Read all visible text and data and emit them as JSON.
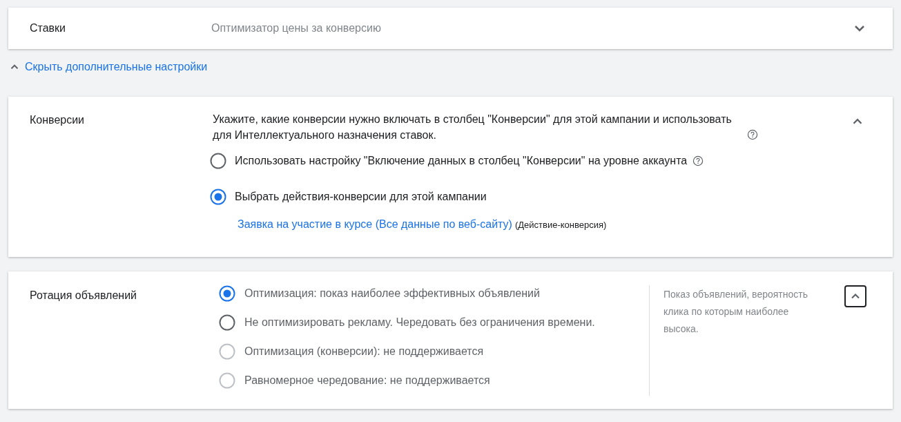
{
  "bids": {
    "label": "Ставки",
    "value": "Оптимизатор цены за конверсию",
    "expanded": false
  },
  "toggle_link": {
    "label": "Скрыть дополнительные настройки",
    "expanded": true
  },
  "conversions": {
    "label": "Конверсии",
    "expanded": true,
    "description": "Укажите, какие конверсии нужно включать в столбец \"Конверсии\" для этой кампании и использовать для Интеллектуального назначения ставок.",
    "options": [
      {
        "label": "Использовать настройку \"Включение данных в столбец \"Конверсии\" на уровне аккаунта",
        "selected": false,
        "help": true
      },
      {
        "label": "Выбрать действия-конверсии для этой кампании",
        "selected": true,
        "help": false
      }
    ],
    "action_link": "Заявка на участие в курсе (Все данные по веб-сайту)",
    "action_type": "(Действие-конверсия)"
  },
  "ad_rotation": {
    "label": "Ротация объявлений",
    "expanded": true,
    "focused": true,
    "options": [
      {
        "label": "Оптимизация: показ наиболее эффективных объявлений",
        "selected": true,
        "disabled": false
      },
      {
        "label": "Не оптимизировать рекламу. Чередовать без ограничения времени.",
        "selected": false,
        "disabled": false
      },
      {
        "label": "Оптимизация (конверсии): не поддерживается",
        "selected": false,
        "disabled": true
      },
      {
        "label": "Равномерное чередование: не поддерживается",
        "selected": false,
        "disabled": true
      }
    ],
    "hint": "Показ объявлений, вероятность клика по которым наиболее высока."
  }
}
